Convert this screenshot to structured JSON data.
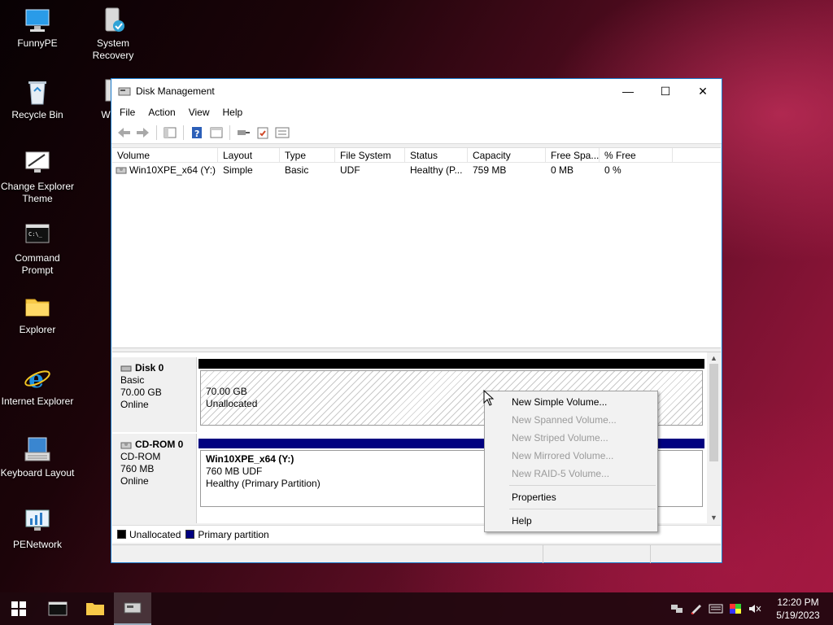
{
  "desktop": {
    "icons": [
      {
        "label": "FunnyPE",
        "icon": "computer-icon"
      },
      {
        "label": "System Recovery",
        "icon": "recovery-icon"
      },
      {
        "label": "Recycle Bin",
        "icon": "recycle-bin-icon"
      },
      {
        "label": "WinN",
        "icon": "winnt-icon"
      },
      {
        "label": "Change Explorer Theme",
        "icon": "theme-icon"
      },
      {
        "label": "Command Prompt",
        "icon": "cmd-icon"
      },
      {
        "label": "Explorer",
        "icon": "folder-icon"
      },
      {
        "label": "Internet Explorer",
        "icon": "ie-icon"
      },
      {
        "label": "Keyboard Layout",
        "icon": "keyboard-icon"
      },
      {
        "label": "PENetwork",
        "icon": "network-icon"
      }
    ]
  },
  "window": {
    "title": "Disk Management",
    "menu": [
      "File",
      "Action",
      "View",
      "Help"
    ],
    "list": {
      "columns": [
        "Volume",
        "Layout",
        "Type",
        "File System",
        "Status",
        "Capacity",
        "Free Spa...",
        "% Free"
      ],
      "rows": [
        [
          "Win10XPE_x64 (Y:)",
          "Simple",
          "Basic",
          "UDF",
          "Healthy (P...",
          "759 MB",
          "0 MB",
          "0 %"
        ]
      ]
    },
    "disks": [
      {
        "name": "Disk 0",
        "type": "Basic",
        "size": "70.00 GB",
        "status": "Online",
        "partition": {
          "size": "70.00 GB",
          "desc": "Unallocated"
        }
      },
      {
        "name": "CD-ROM 0",
        "type": "CD-ROM",
        "size": "760 MB",
        "status": "Online",
        "partition": {
          "name": "Win10XPE_x64  (Y:)",
          "size": "760 MB UDF",
          "desc": "Healthy (Primary Partition)"
        }
      }
    ],
    "legend": [
      {
        "label": "Unallocated",
        "color": "#000000"
      },
      {
        "label": "Primary partition",
        "color": "#000080"
      }
    ]
  },
  "context_menu": {
    "items": [
      {
        "label": "New Simple Volume...",
        "enabled": true
      },
      {
        "label": "New Spanned Volume...",
        "enabled": false
      },
      {
        "label": "New Striped Volume...",
        "enabled": false
      },
      {
        "label": "New Mirrored Volume...",
        "enabled": false
      },
      {
        "label": "New RAID-5 Volume...",
        "enabled": false
      },
      {
        "label": "Properties",
        "enabled": true
      },
      {
        "label": "Help",
        "enabled": true
      }
    ]
  },
  "taskbar": {
    "time": "12:20 PM",
    "date": "5/19/2023"
  },
  "colors": {
    "accent": "#1979ca",
    "primary_partition": "#000080",
    "unallocated": "#000000"
  }
}
